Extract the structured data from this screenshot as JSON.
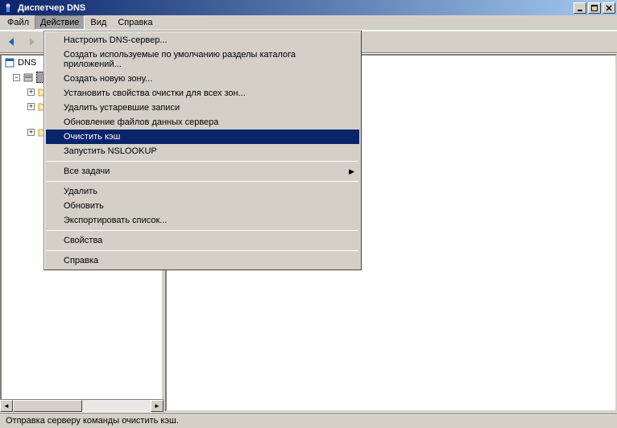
{
  "titlebar": {
    "title": "Диспетчер DNS"
  },
  "menubar": {
    "file": "Файл",
    "action": "Действие",
    "view": "Вид",
    "help": "Справка"
  },
  "tree": {
    "root": "DNS",
    "children": [
      {
        "label": "",
        "expanded": true
      },
      {
        "label": "",
        "depth": 2
      },
      {
        "label": "",
        "depth": 2
      },
      {
        "label": "",
        "depth": 2
      }
    ]
  },
  "dropdown": {
    "items": [
      {
        "label": "Настроить DNS-сервер...",
        "type": "item"
      },
      {
        "label": "Создать используемые по умолчанию разделы каталога приложений...",
        "type": "item"
      },
      {
        "label": "Создать новую зону...",
        "type": "item"
      },
      {
        "label": "Установить свойства очистки для всех зон...",
        "type": "item"
      },
      {
        "label": "Удалить устаревшие записи",
        "type": "item"
      },
      {
        "label": "Обновление файлов данных сервера",
        "type": "item"
      },
      {
        "label": "Очистить кэш",
        "type": "item",
        "highlight": true
      },
      {
        "label": "Запустить NSLOOKUP",
        "type": "item"
      },
      {
        "type": "sep"
      },
      {
        "label": "Все задачи",
        "type": "item",
        "submenu": true
      },
      {
        "type": "sep"
      },
      {
        "label": "Удалить",
        "type": "item"
      },
      {
        "label": "Обновить",
        "type": "item"
      },
      {
        "label": "Экспортировать список...",
        "type": "item"
      },
      {
        "type": "sep"
      },
      {
        "label": "Свойства",
        "type": "item"
      },
      {
        "type": "sep"
      },
      {
        "label": "Справка",
        "type": "item"
      }
    ]
  },
  "statusbar": {
    "text": "Отправка серверу команды очистить кэш."
  }
}
